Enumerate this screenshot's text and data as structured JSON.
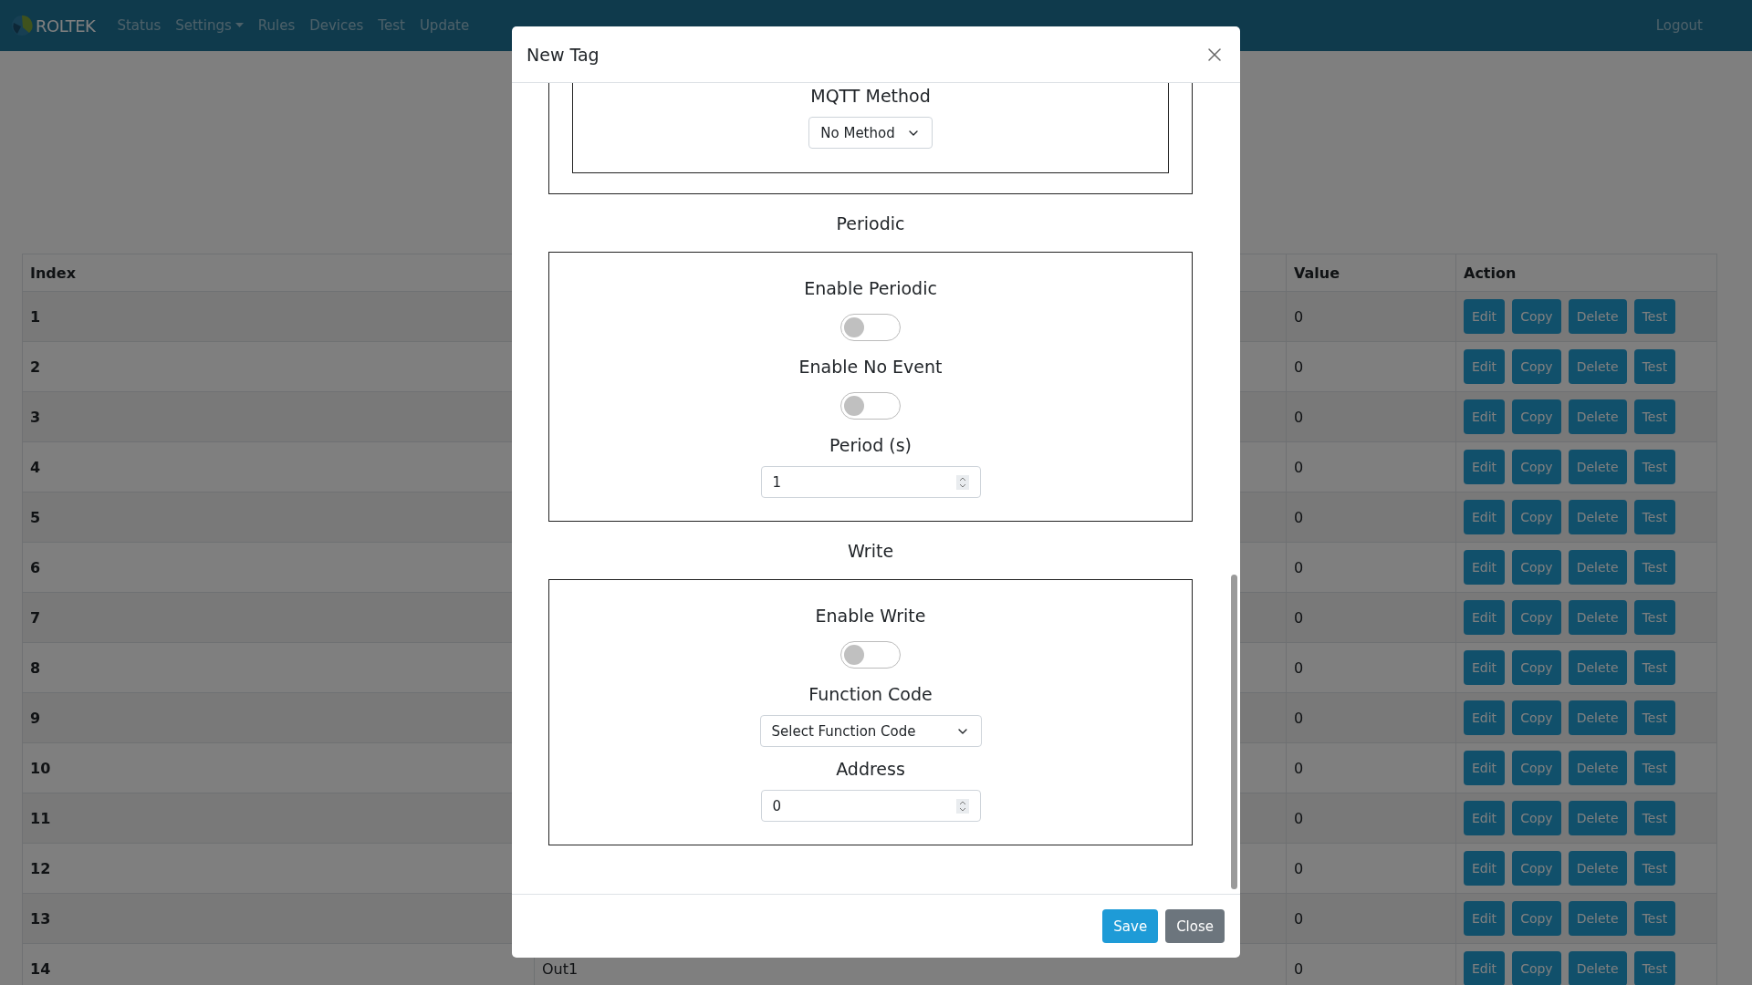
{
  "navbar": {
    "brand": "ROLTEK",
    "items": [
      {
        "label": "Status",
        "dropdown": false
      },
      {
        "label": "Settings",
        "dropdown": true
      },
      {
        "label": "Rules",
        "dropdown": false
      },
      {
        "label": "Devices",
        "dropdown": false
      },
      {
        "label": "Test",
        "dropdown": false
      },
      {
        "label": "Update",
        "dropdown": false
      }
    ],
    "logout": "Logout"
  },
  "table": {
    "columns": {
      "index": "Index",
      "value": "Value",
      "action": "Action"
    },
    "rows": [
      {
        "index": "1",
        "value": "0",
        "actions": [
          "Edit",
          "Copy",
          "Delete",
          "Test"
        ]
      },
      {
        "index": "2",
        "value": "0",
        "actions": [
          "Edit",
          "Copy",
          "Delete",
          "Test"
        ]
      },
      {
        "index": "3",
        "value": "0",
        "actions": [
          "Edit",
          "Copy",
          "Delete",
          "Test"
        ]
      },
      {
        "index": "4",
        "value": "0",
        "actions": [
          "Edit",
          "Copy",
          "Delete",
          "Test"
        ]
      },
      {
        "index": "5",
        "value": "0",
        "actions": [
          "Edit",
          "Copy",
          "Delete",
          "Test"
        ]
      },
      {
        "index": "6",
        "value": "0",
        "actions": [
          "Edit",
          "Copy",
          "Delete",
          "Test"
        ]
      },
      {
        "index": "7",
        "value": "0",
        "actions": [
          "Edit",
          "Copy",
          "Delete",
          "Test"
        ]
      },
      {
        "index": "8",
        "value": "0",
        "actions": [
          "Edit",
          "Copy",
          "Delete",
          "Test"
        ]
      },
      {
        "index": "9",
        "value": "0",
        "actions": [
          "Edit",
          "Copy",
          "Delete",
          "Test"
        ]
      },
      {
        "index": "10",
        "value": "0",
        "actions": [
          "Edit",
          "Copy",
          "Delete",
          "Test"
        ]
      },
      {
        "index": "11",
        "value": "0",
        "actions": [
          "Edit",
          "Copy",
          "Delete",
          "Test"
        ]
      },
      {
        "index": "12",
        "value": "0",
        "actions": [
          "Edit",
          "Copy",
          "Delete",
          "Test"
        ]
      },
      {
        "index": "13",
        "value": "0",
        "actions": [
          "Edit",
          "Copy",
          "Delete",
          "Test"
        ]
      },
      {
        "index": "14",
        "column_2": "Out1",
        "value": "0",
        "actions": [
          "Edit",
          "Copy",
          "Delete",
          "Test"
        ]
      }
    ]
  },
  "modal": {
    "title": "New Tag",
    "top_section": {
      "label": "MQTT Method",
      "select": "No Method"
    },
    "sections": [
      {
        "heading": "Periodic",
        "fields": [
          {
            "kind": "switch",
            "label": "Enable Periodic",
            "on": false
          },
          {
            "kind": "switch",
            "label": "Enable No Event",
            "on": false
          },
          {
            "kind": "number",
            "label": "Period (s)",
            "value": "1"
          }
        ]
      },
      {
        "heading": "Write",
        "fields": [
          {
            "kind": "switch",
            "label": "Enable Write",
            "on": false
          },
          {
            "kind": "select",
            "label": "Function Code",
            "value": "Select Function Code"
          },
          {
            "kind": "number",
            "label": "Address",
            "value": "0"
          }
        ]
      }
    ],
    "buttons": [
      {
        "kind": "primary",
        "label": "Save"
      },
      {
        "kind": "secondary",
        "label": "Close"
      }
    ]
  }
}
